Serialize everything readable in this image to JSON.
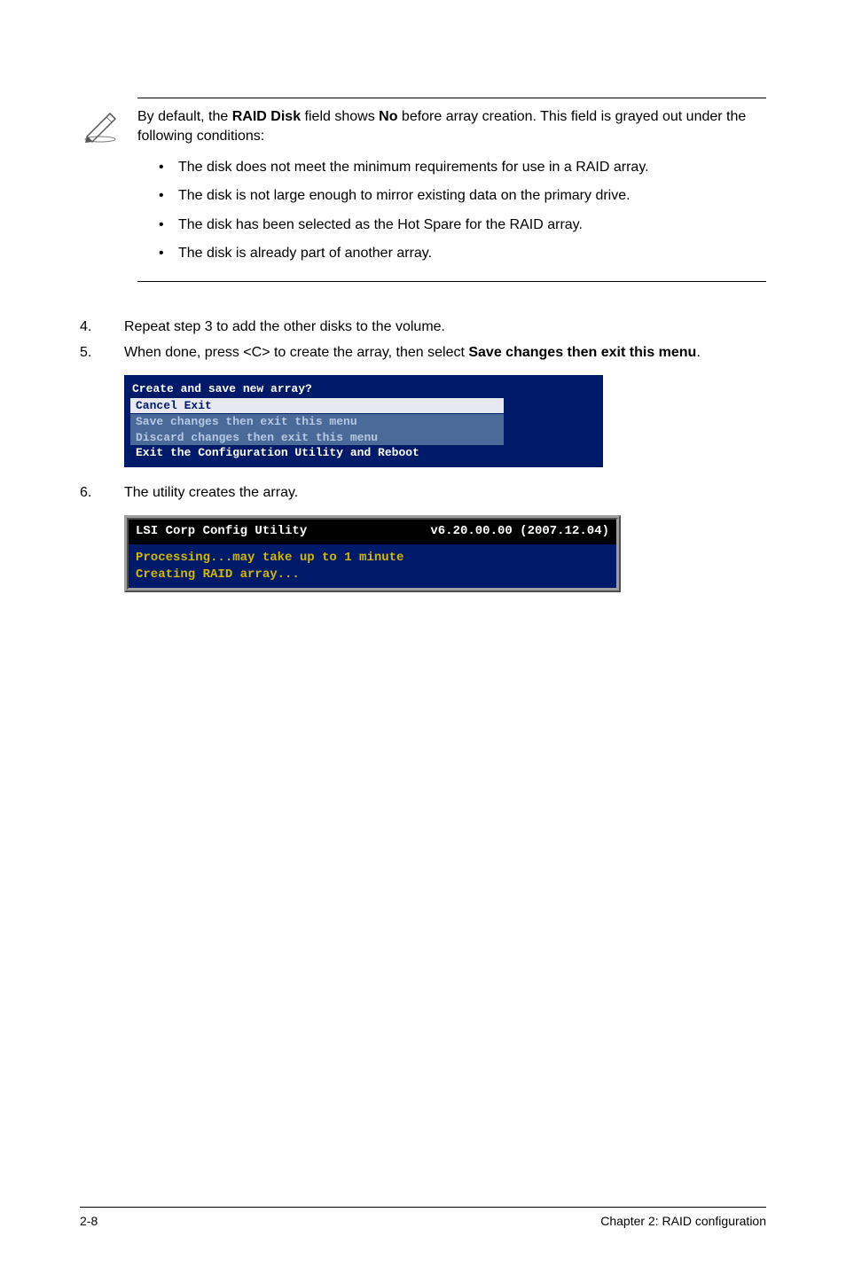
{
  "note": {
    "lead_pre": "By default, the ",
    "lead_bold1": "RAID Disk",
    "lead_mid": " field shows ",
    "lead_bold2": "No",
    "lead_post": " before array creation. This field is grayed out under the following conditions:",
    "bullets": [
      "The disk does not meet the minimum requirements for use in a RAID array.",
      "The disk is not large enough to mirror existing data on the primary drive.",
      "The disk has been selected as the Hot Spare for the RAID array.",
      "The disk is already part of another array."
    ]
  },
  "steps": {
    "s4_num": "4.",
    "s4_text": "Repeat step 3 to add the other disks to the volume.",
    "s5_num": "5.",
    "s5_pre": "When done, press <C> to create the array, then select ",
    "s5_bold": "Save changes then exit this menu",
    "s5_post": ".",
    "s6_num": "6.",
    "s6_text": "The utility creates the array."
  },
  "menu": {
    "title": "Create and save new array?",
    "cancel": "Cancel Exit",
    "save": "Save changes then exit this menu",
    "discard": "Discard changes then exit this menu",
    "exit": "Exit the Configuration Utility and Reboot"
  },
  "proc": {
    "header_left": "LSI Corp Config Utility",
    "header_right": "v6.20.00.00 (2007.12.04)",
    "line1": "Processing...may take up to 1 minute",
    "line2": "Creating RAID array..."
  },
  "footer": {
    "left": "2-8",
    "right": "Chapter 2: RAID configuration"
  }
}
